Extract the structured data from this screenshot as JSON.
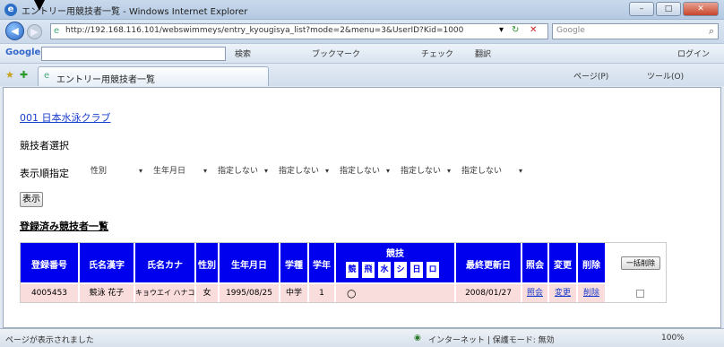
{
  "window": {
    "title": "エントリー用競技者一覧 - Windows Internet Explorer",
    "min": "–",
    "max": "□",
    "close": "✕"
  },
  "address": {
    "url": "http://192.168.116.101/webswimmeys/entry_kyougisya_list?mode=2&menu=3&UserID?Kid=1000",
    "search_placeholder": "Google"
  },
  "gbar": {
    "label": "Google",
    "items": [
      "検索",
      "ブックマーク",
      "チェック",
      "翻訳",
      "ログイン"
    ]
  },
  "tabs": {
    "active": "エントリー用競技者一覧",
    "tools": [
      "ページ(P)",
      "ツール(O)"
    ]
  },
  "page": {
    "club": "001 日本水泳クラブ",
    "select_label": "競技者選択",
    "filter_label": "表示順指定",
    "filters": [
      "性別",
      "生年月日",
      "指定しない",
      "指定しない",
      "指定しない",
      "指定しない",
      "指定しない"
    ],
    "show_button": "表示",
    "list_heading": "登録済み競技者一覧"
  },
  "table": {
    "headers": [
      "登録番号",
      "氏名漢字",
      "氏名カナ",
      "性別",
      "生年月日",
      "学種",
      "学年",
      "競技",
      "最終更新日",
      "照会",
      "変更",
      "削除"
    ],
    "event_subs": [
      "競",
      "飛",
      "水",
      "シ",
      "日",
      "ロ"
    ],
    "clear_button": "一括削除",
    "rows": [
      {
        "id": "4005453",
        "name_kanji": "競泳 花子",
        "name_kana": "キョウエイ ハナコ",
        "gender": "女",
        "birth": "1995/08/25",
        "school": "中学",
        "grade": "1",
        "event_mark": "○",
        "updated": "2008/01/27",
        "view": "照会",
        "edit": "変更",
        "delete": "削除"
      }
    ]
  },
  "status": {
    "left": "ページが表示されました",
    "zone": "インターネット | 保護モード: 無効",
    "zoom": "100%"
  }
}
